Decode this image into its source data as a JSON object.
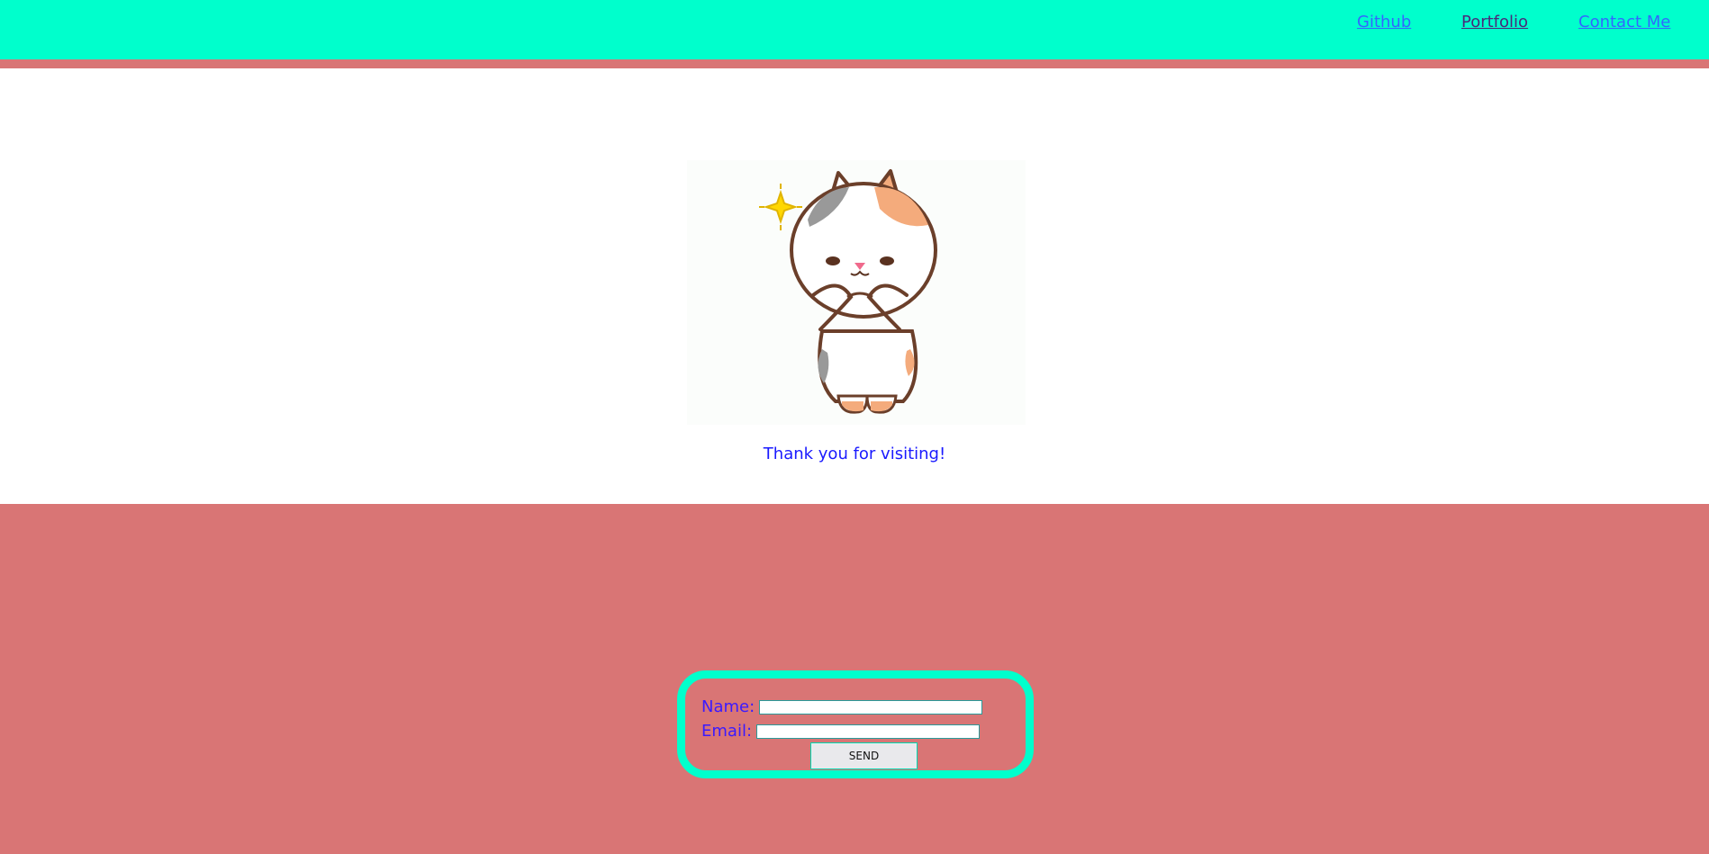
{
  "nav": {
    "github": "Github",
    "portfolio": "Portfolio",
    "contact": "Contact Me"
  },
  "hero": {
    "message": "Thank you for visiting!"
  },
  "contact_form": {
    "name_label": "Name:",
    "email_label": "Email:",
    "name_value": "",
    "email_value": "",
    "send_label": "SEND"
  },
  "colors": {
    "accent": "#00FFCC",
    "footer": "#D97575",
    "text": "#1a1aff"
  }
}
